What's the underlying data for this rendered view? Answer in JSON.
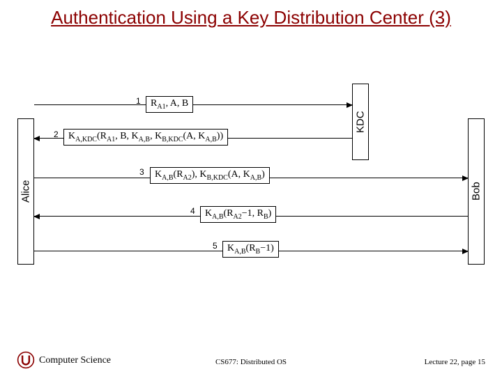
{
  "title": "Authentication Using a Key Distribution Center (3)",
  "parties": {
    "alice": "Alice",
    "kdc": "KDC",
    "bob": "Bob"
  },
  "messages": {
    "m1": {
      "num": "1",
      "textA": "R",
      "subA": "A1",
      "rest": ", A, B"
    },
    "m2": {
      "num": "2",
      "k1": "K",
      "k1sub": "A,KDC",
      "open": "(R",
      "r1sub": "A1",
      "mid1": ", B, K",
      "kabsub": "A,B",
      "mid2": ", K",
      "kbkdcsub": "B,KDC",
      "mid3": "(A, K",
      "kabsub2": "A,B",
      "close": "))"
    },
    "m3": {
      "num": "3",
      "k1": "K",
      "k1sub": "A,B",
      "open": "(R",
      "r2sub": "A2",
      "mid1": "), K",
      "kbkdcsub": "B,KDC",
      "mid2": "(A, K",
      "kabsub": "A,B",
      "close": ")"
    },
    "m4": {
      "num": "4",
      "k1": "K",
      "k1sub": "A,B",
      "open": "(R",
      "r2sub": "A2",
      "mid": "−1, R",
      "rbsub": "B",
      "close": ")"
    },
    "m5": {
      "num": "5",
      "k1": "K",
      "k1sub": "A,B",
      "open": "(R",
      "rbsub": "B",
      "close": "−1)"
    }
  },
  "footer": {
    "dept": "Computer Science",
    "course": "CS677: Distributed OS",
    "page": "Lecture 22, page 15"
  },
  "colors": {
    "title": "#8b0000"
  }
}
